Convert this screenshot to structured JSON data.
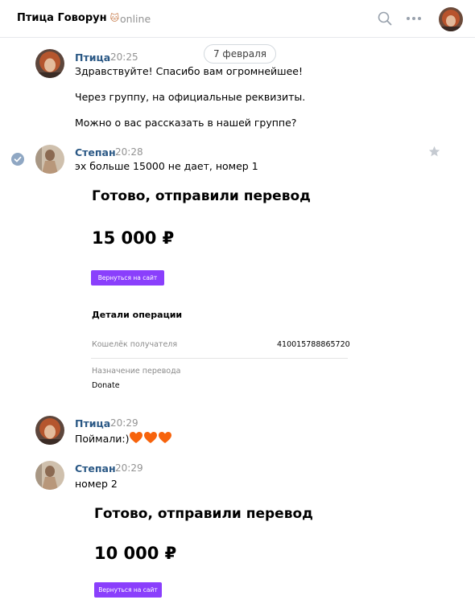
{
  "header": {
    "title": "Птица Говорун",
    "title_emoji": "🐱",
    "status": "online"
  },
  "date_divider": "7 февраля",
  "messages": [
    {
      "author": "Птица",
      "time": "20:25",
      "lines": [
        "Здравствуйте! Спасибо вам огромнейшее!",
        "Через группу, на официальные реквизиты.",
        "Можно о вас рассказать в нашей группе?"
      ]
    },
    {
      "author": "Степан",
      "time": "20:28",
      "lines": [
        "эх больше 15000 не дает, номер 1"
      ],
      "attachment": {
        "title": "Готово, отправили перевод",
        "amount": "15 000 ₽",
        "button": "Вернуться на сайт",
        "details_title": "Детали операции",
        "wallet_label": "Кошелёк получателя",
        "wallet_value": "410015788865720",
        "purpose_label": "Назначение перевода",
        "purpose_value": "Donate"
      }
    },
    {
      "author": "Птица",
      "time": "20:29",
      "lines": [
        "Поймали:)"
      ],
      "hearts": "🧡🧡🧡"
    },
    {
      "author": "Степан",
      "time": "20:29",
      "lines": [
        "номер 2"
      ],
      "attachment": {
        "title": "Готово, отправили перевод",
        "amount": "10 000 ₽",
        "button": "Вернуться на сайт"
      }
    }
  ],
  "colors": {
    "author_link": "#2a5885",
    "button_purple": "#8a3ffc",
    "muted": "#939393",
    "heart": "#f7630c"
  },
  "icons": [
    "search-icon",
    "more-icon",
    "check-circle-icon",
    "star-icon"
  ]
}
